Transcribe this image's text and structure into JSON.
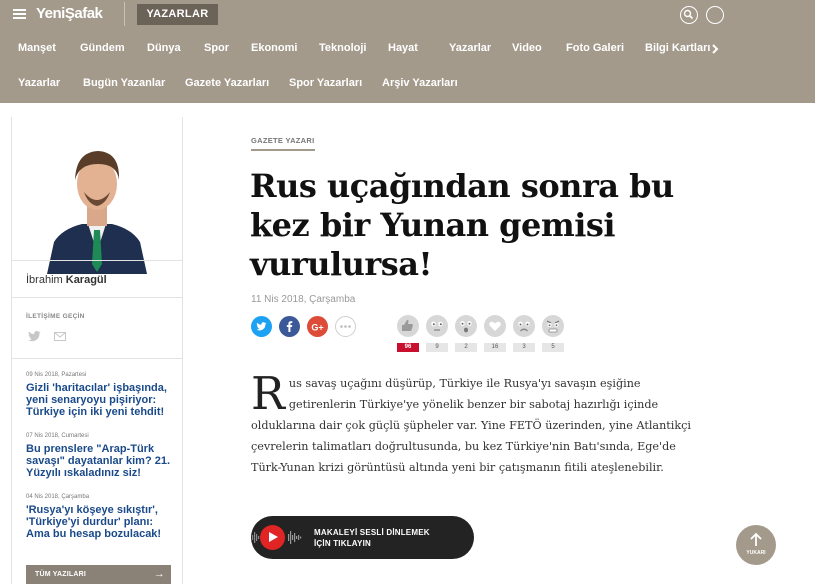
{
  "header": {
    "logo": "YeniŞafak",
    "section": "YAZARLAR"
  },
  "nav_main": [
    "Manşet",
    "Gündem",
    "Dünya",
    "Spor",
    "Ekonomi",
    "Teknoloji",
    "Hayat",
    "Yazarlar",
    "Video",
    "Foto Galeri",
    "Bilgi Kartları"
  ],
  "nav_sub": [
    "Yazarlar",
    "Bugün Yazanlar",
    "Gazete Yazarları",
    "Spor Yazarları",
    "Arşiv Yazarları"
  ],
  "sidebar": {
    "author_first": "İbrahim",
    "author_last": "Karagül",
    "contact_label": "İLETİŞİME GEÇİN",
    "articles": [
      {
        "date": "09 Nis 2018, Pazartesi",
        "title": "Gizli 'haritacılar' işbaşında, yeni senaryoyu pişiriyor: Türkiye için iki yeni tehdit!"
      },
      {
        "date": "07 Nis 2018, Cumartesi",
        "title": "Bu prenslere \"Arap-Türk savaşı\" dayatanlar kim? 21. Yüzyılı ıskaladınız siz!"
      },
      {
        "date": "04 Nis 2018, Çarşamba",
        "title": "'Rusya'yı köşeye sıkıştır', 'Türkiye'yi durdur' planı: Ama bu hesap bozulacak!"
      }
    ],
    "all_articles": "TÜM YAZILARI"
  },
  "article": {
    "category": "GAZETE YAZARI",
    "title": "Rus uçağından sonra bu kez bir Yunan gemisi vurulursa!",
    "date": "11 Nis 2018, Çarşamba",
    "dropcap": "R",
    "body": "us savaş uçağını düşürüp, Türkiye ile Rusya'yı savaşın eşiğine getirenlerin Türkiye'ye yönelik benzer bir sabotaj hazırlığı içinde olduklarına dair çok güçlü şüpheler var. Yine FETÖ üzerinden, yine Atlantikçi çevrelerin talimatları doğrultusunda, bu kez Türkiye'nin Batı'sında, Ege'de Türk-Yunan krizi görüntüsü altında yeni bir çatışmanın fitili ateşlenebilir.",
    "audio_line1": "MAKALEYİ SESLİ DİNLEMEK",
    "audio_line2": "İÇİN TIKLAYIN"
  },
  "reactions": [
    {
      "icon": "thumbs-up-icon",
      "count": "96"
    },
    {
      "icon": "neutral-face-icon",
      "count": "9"
    },
    {
      "icon": "surprised-face-icon",
      "count": "2"
    },
    {
      "icon": "heart-icon",
      "count": "16"
    },
    {
      "icon": "sad-face-icon",
      "count": "3"
    },
    {
      "icon": "angry-face-icon",
      "count": "5"
    }
  ],
  "up_label": "YUKARI",
  "colors": {
    "header_bg": "#a49a8c",
    "link_blue": "#1a4a8a",
    "accent_red": "#c8102e",
    "twitter": "#1da1f2",
    "facebook": "#3b5998",
    "google": "#dd4b39"
  }
}
